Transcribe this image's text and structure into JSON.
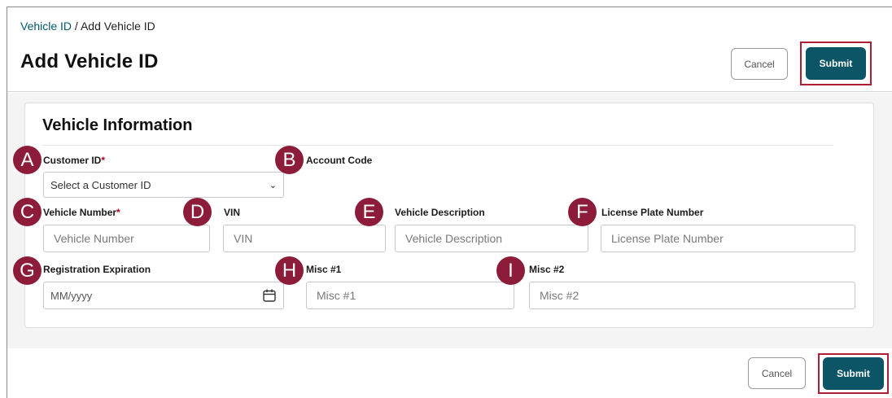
{
  "breadcrumb": {
    "link": "Vehicle ID",
    "separator": " / ",
    "current": "Add Vehicle ID"
  },
  "page_title": "Add Vehicle ID",
  "section_title": "Vehicle Information",
  "fields": {
    "customer_id": {
      "label": "Customer ID",
      "required_mark": "*",
      "value": "Select a Customer ID"
    },
    "account_code": {
      "label": "Account Code"
    },
    "vehicle_number": {
      "label": "Vehicle Number",
      "required_mark": "*",
      "placeholder": "Vehicle Number"
    },
    "vin": {
      "label": "VIN",
      "placeholder": "VIN"
    },
    "vehicle_description": {
      "label": "Vehicle Description",
      "placeholder": "Vehicle Description"
    },
    "license_plate": {
      "label": "License Plate Number",
      "placeholder": "License Plate Number"
    },
    "registration_expiration": {
      "label": "Registration Expiration",
      "placeholder": "MM/yyyy"
    },
    "misc1": {
      "label": "Misc #1",
      "placeholder": "Misc #1"
    },
    "misc2": {
      "label": "Misc #2",
      "placeholder": "Misc #2"
    }
  },
  "markers": {
    "a": "A",
    "b": "B",
    "c": "C",
    "d": "D",
    "e": "E",
    "f": "F",
    "g": "G",
    "h": "H",
    "i": "I"
  },
  "buttons": {
    "cancel": "Cancel",
    "submit": "Submit"
  },
  "colors": {
    "brand_teal": "#0b5566",
    "marker": "#8c1c3a",
    "highlight": "#b01e35",
    "required": "#b0001e"
  },
  "icons": {
    "select_chevron": "chevron-down-icon",
    "date_picker": "calendar-icon"
  }
}
